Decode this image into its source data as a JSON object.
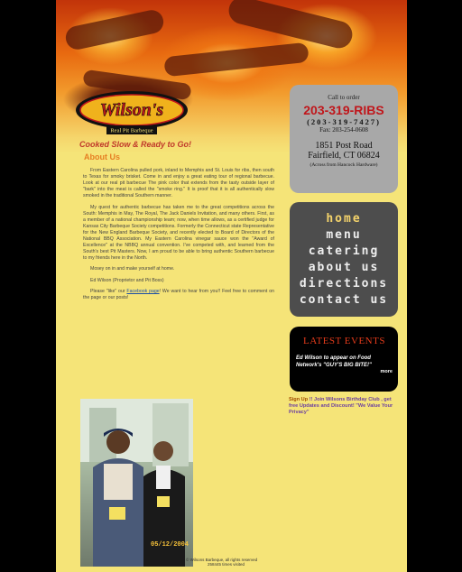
{
  "brand": {
    "name": "Wilson's",
    "sub": "Real Pit Barbeque"
  },
  "tagline": "Cooked Slow & Ready to Go!",
  "subtitle": "About Us",
  "paragraphs": [
    "From Eastern Carolina pulled pork, inland to Memphis and St. Louis for ribs, then south to Texas for smoky brisket. Come in and enjoy a great eating tour of regional barbecue. Look at our real pit barbecue The pink color that extends from the tasty outside layer of \"bark\" into the meat is called the \"smoke ring.\" It is proof that it is all authentically slow smoked in the traditional Southern manner.",
    "My quest for authentic barbecue has taken me to the great competitions across the South: Memphis in May, The Royal, The Jack Daniels Invitation, and many others. First, as a member of a national championship team; now, when time allows, as a certified judge for Kansas City Barbeque Society competitions. Formerly the Connecticut state Representative for the New England Barbeque Society, and recently elected to Board of Directors of the National BBQ Association. My Eastern Carolina vinegar sauce won the \"Award of Excellence\" at the NBBQ annual convention. I've competed with, and learned from the South's best Pit Masters. Now, I am proud to be able to bring authentic Southern barbecue to my friends here in the North.",
    "Mosey on in and make yourself at home.",
    "Ed Wilson (Proprietor and Pit Boss)"
  ],
  "facebook": {
    "pre": "Please \"like\" our ",
    "link": "Facebook page",
    "post": "! We want to hear from you!! Feel free to comment on the page or our posts!"
  },
  "photo": {
    "date": "05/12/2004"
  },
  "caption": {
    "line1": "© Wilsons Barbeque, all rights reserved",
    "line2": "258445 times visited"
  },
  "order": {
    "call": "Call to order",
    "phone": "203-319-RIBS",
    "digits": "(203-319-7427)",
    "fax": "Fax: 203-254-0608",
    "addr1": "1851 Post Road",
    "addr2": "Fairfield, CT 06824",
    "note": "(Across from Hancock Hardware)"
  },
  "nav": [
    "home",
    "menu",
    "catering",
    "about us",
    "directions",
    "contact us"
  ],
  "events": {
    "title": "LATEST EVENTS",
    "text": "Ed Wilson to appear on Food Network's \"GUY'S BIG BITE!\"",
    "more": "more"
  },
  "signup": {
    "link": "Sign Up",
    "mid": " !! Join Wilsons Birthday Club , get free Updates and Discount! \"We Value Your Privacy\""
  },
  "colors": {
    "page": "#f5e478",
    "tagline": "#c0392b",
    "phone": "#c0161b",
    "nav_active": "#f4d36b"
  }
}
